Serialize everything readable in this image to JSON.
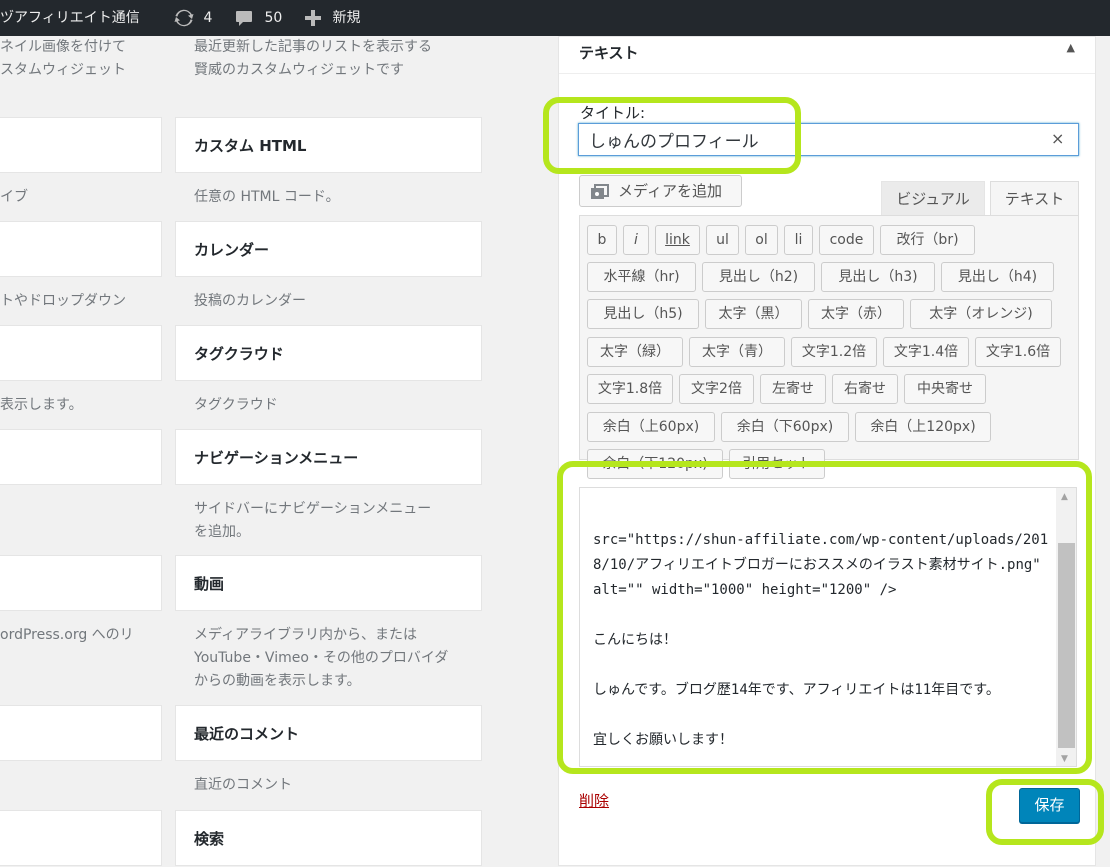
{
  "admin_bar": {
    "site_name": "ヅアフィリエイト通信",
    "updates_count": "4",
    "comments_count": "50",
    "new_label": "新規"
  },
  "widgets": {
    "top_descs": {
      "left": [
        "ネイル画像を付けて",
        "スタムウィジェット"
      ],
      "right": [
        "最近更新した記事のリストを表示する",
        "賢威のカスタムウィジェットです"
      ]
    },
    "left_descs": [
      "イブ",
      "トやドロップダウン",
      "表示します。",
      "ordPress.org へのリ"
    ],
    "right_items": [
      {
        "title": "カスタム HTML",
        "desc": [
          "任意の HTML コード。"
        ]
      },
      {
        "title": "カレンダー",
        "desc": [
          "投稿のカレンダー"
        ]
      },
      {
        "title": "タグクラウド",
        "desc": [
          "タグクラウド"
        ]
      },
      {
        "title": "ナビゲーションメニュー",
        "desc": [
          "サイドバーにナビゲーションメニュー",
          "を追加。"
        ]
      },
      {
        "title": "動画",
        "desc": [
          "メディアライブラリ内から、または",
          "YouTube・Vimeo・その他のプロバイダ",
          "からの動画を表示します。"
        ]
      },
      {
        "title": "最近のコメント",
        "desc": [
          "直近のコメント"
        ]
      },
      {
        "title": "検索",
        "desc": []
      }
    ]
  },
  "panel": {
    "header_title": "テキスト",
    "title_label": "タイトル:",
    "title_value": "しゅんのプロフィール",
    "media_button": "メディアを追加",
    "tab_visual": "ビジュアル",
    "tab_text": "テキスト",
    "quicktags": [
      "b",
      "i",
      "link",
      "ul",
      "ol",
      "li",
      "code",
      "改行（br)",
      "水平線（hr)",
      "見出し（h2)",
      "見出し（h3)",
      "見出し（h4)",
      "見出し（h5)",
      "太字（黒）",
      "太字（赤）",
      "太字（オレンジ)",
      "太字（緑）",
      "太字（青）",
      "文字1.2倍",
      "文字1.4倍",
      "文字1.6倍",
      "文字1.8倍",
      "文字2倍",
      "左寄せ",
      "右寄せ",
      "中央寄せ",
      "余白（上60px)",
      "余白（下60px)",
      "余白（上120px)",
      "余白（下120px)",
      "引用セット"
    ],
    "editor_content": "src=\"https://shun-affiliate.com/wp-content/uploads/2018/10/アフィリエイトブロガーにおススメのイラスト素材サイト.png\" alt=\"\" width=\"1000\" height=\"1200\" />\n\nこんにちは！\n\nしゅんです。ブログ歴14年です、アフィリエイトは11年目です。\n\n宜しくお願いします！",
    "delete_label": "削除",
    "save_label": "保存"
  },
  "colors": {
    "highlight": "#b5e61d",
    "primary_button": "#0085ba",
    "admin_bar": "#23282d",
    "delete_link": "#aa0000"
  }
}
